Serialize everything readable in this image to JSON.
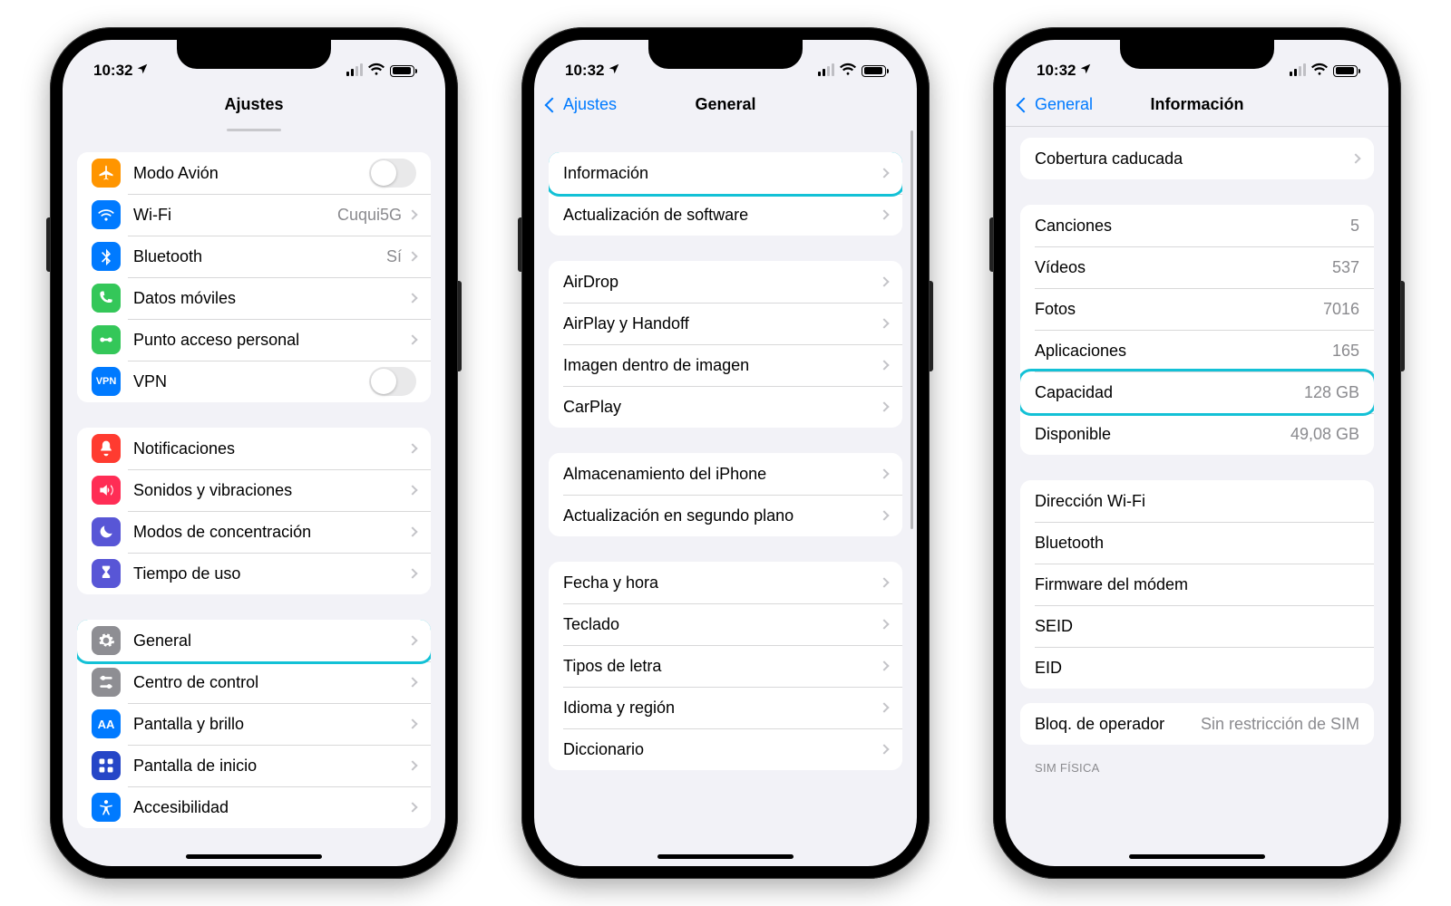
{
  "status": {
    "time": "10:32"
  },
  "phone1": {
    "title": "Ajustes",
    "g1": {
      "airplane": "Modo Avión",
      "wifi": "Wi-Fi",
      "wifi_val": "Cuqui5G",
      "bt": "Bluetooth",
      "bt_val": "Sí",
      "cell": "Datos móviles",
      "hotspot": "Punto acceso personal",
      "vpn": "VPN"
    },
    "g2": {
      "notif": "Notificaciones",
      "sounds": "Sonidos y vibraciones",
      "focus": "Modos de concentración",
      "screentime": "Tiempo de uso"
    },
    "g3": {
      "general": "General",
      "control": "Centro de control",
      "display": "Pantalla y brillo",
      "home": "Pantalla de inicio",
      "access": "Accesibilidad"
    }
  },
  "phone2": {
    "back": "Ajustes",
    "title": "General",
    "g1": {
      "info": "Información",
      "update": "Actualización de software"
    },
    "g2": {
      "airdrop": "AirDrop",
      "airplay": "AirPlay y Handoff",
      "pip": "Imagen dentro de imagen",
      "carplay": "CarPlay"
    },
    "g3": {
      "storage": "Almacenamiento del iPhone",
      "bgrefresh": "Actualización en segundo plano"
    },
    "g4": {
      "date": "Fecha y hora",
      "keyboard": "Teclado",
      "fonts": "Tipos de letra",
      "lang": "Idioma y región",
      "dict": "Diccionario"
    }
  },
  "phone3": {
    "back": "General",
    "title": "Información",
    "g1": {
      "coverage": "Cobertura caducada"
    },
    "g2": {
      "songs": "Canciones",
      "songs_v": "5",
      "videos": "Vídeos",
      "videos_v": "537",
      "photos": "Fotos",
      "photos_v": "7016",
      "apps": "Aplicaciones",
      "apps_v": "165",
      "capacity": "Capacidad",
      "capacity_v": "128 GB",
      "avail": "Disponible",
      "avail_v": "49,08 GB"
    },
    "g3": {
      "wifi_addr": "Dirección Wi-Fi",
      "bt": "Bluetooth",
      "modem": "Firmware del módem",
      "seid": "SEID",
      "eid": "EID"
    },
    "g4": {
      "carrier": "Bloq. de operador",
      "carrier_v": "Sin restricción de SIM"
    },
    "footer": "SIM FÍSICA"
  }
}
